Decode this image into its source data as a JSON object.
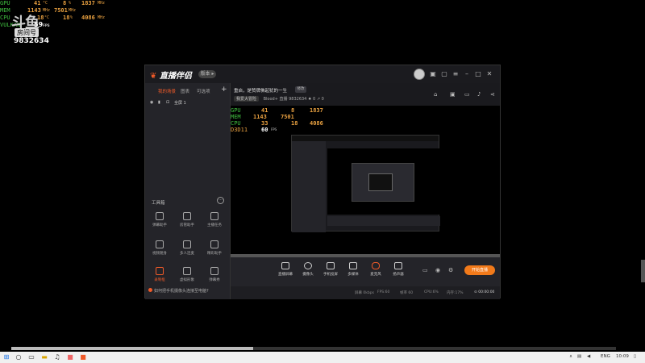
{
  "overlay": {
    "rows": [
      {
        "label": "GPU",
        "val1": "41",
        "unit1": "°C",
        "val2": "8",
        "unit2": "%",
        "val3": "1837",
        "unit3": "MHz"
      },
      {
        "label": "MEM",
        "val1": "1143",
        "unit1": "MHz",
        "val2": "7501",
        "unit2": "MHz",
        "val3": "",
        "unit3": ""
      },
      {
        "label": "CPU",
        "val1": "18",
        "unit1": "°C",
        "val2": "18",
        "unit2": "%",
        "val3": "4086",
        "unit3": "MHz"
      },
      {
        "label": "VULKAN",
        "val1": "59",
        "unit1": "FPS",
        "val2": "",
        "unit2": "",
        "val3": "",
        "unit3": ""
      }
    ],
    "logo_text": "斗鱼",
    "logo_tag": "房间号",
    "room_id": "9832634"
  },
  "window": {
    "app_name": "直播伴侣",
    "version_pill": "版本 ▸",
    "sidebar": {
      "tabs": [
        "我的场景",
        "图表",
        "可选项"
      ],
      "active_tab": 0,
      "add_label": "+",
      "scene_name": "全屏 1",
      "tools_title": "工具箱",
      "tools_more": "···",
      "tools": [
        {
          "label": "弹幕助手"
        },
        {
          "label": "房管助手"
        },
        {
          "label": "主播任务"
        },
        {
          "label": "视频随身"
        },
        {
          "label": "多人连麦"
        },
        {
          "label": "精彩助手"
        },
        {
          "label": "录制框",
          "active": true
        },
        {
          "label": "虚拟形象"
        },
        {
          "label": "弹幕秀"
        }
      ],
      "footer_tip": "如何把手机摄像头连接至电脑?"
    },
    "header": {
      "room_title": "重启，是赞牌佛起犹的一生",
      "edit_label": "修改",
      "category": "我爱大冒险",
      "meta_text": "Blood+ 直播   9832634",
      "likes": "0",
      "shares": "0"
    },
    "preview_osd": {
      "rows": [
        {
          "label": "GPU",
          "v1": "41",
          "v2": "8",
          "v3": "1837"
        },
        {
          "label": "MEM",
          "v1": "1143",
          "v2": "7501",
          "v3": ""
        },
        {
          "label": "CPU",
          "v1": "33",
          "v2": "18",
          "v3": "4086"
        },
        {
          "label": "D3D11",
          "v1": "60",
          "v2": "FPS",
          "v3": ""
        }
      ]
    },
    "controls": [
      {
        "label": "直播屏幕"
      },
      {
        "label": "摄像头"
      },
      {
        "label": "手机投屏"
      },
      {
        "label": "多媒体"
      },
      {
        "label": "麦克风"
      },
      {
        "label": "扬声器"
      }
    ],
    "go_live": "开始直播",
    "status": {
      "a": "屏幕 0kbps",
      "b": "FPS:60",
      "c": "帧率 60",
      "d": "CPU:6%",
      "e": "内存:17%",
      "time": "00:00:00"
    }
  },
  "taskbar": {
    "progress": 0.4,
    "lang": "ENG",
    "clock": "10:09"
  }
}
